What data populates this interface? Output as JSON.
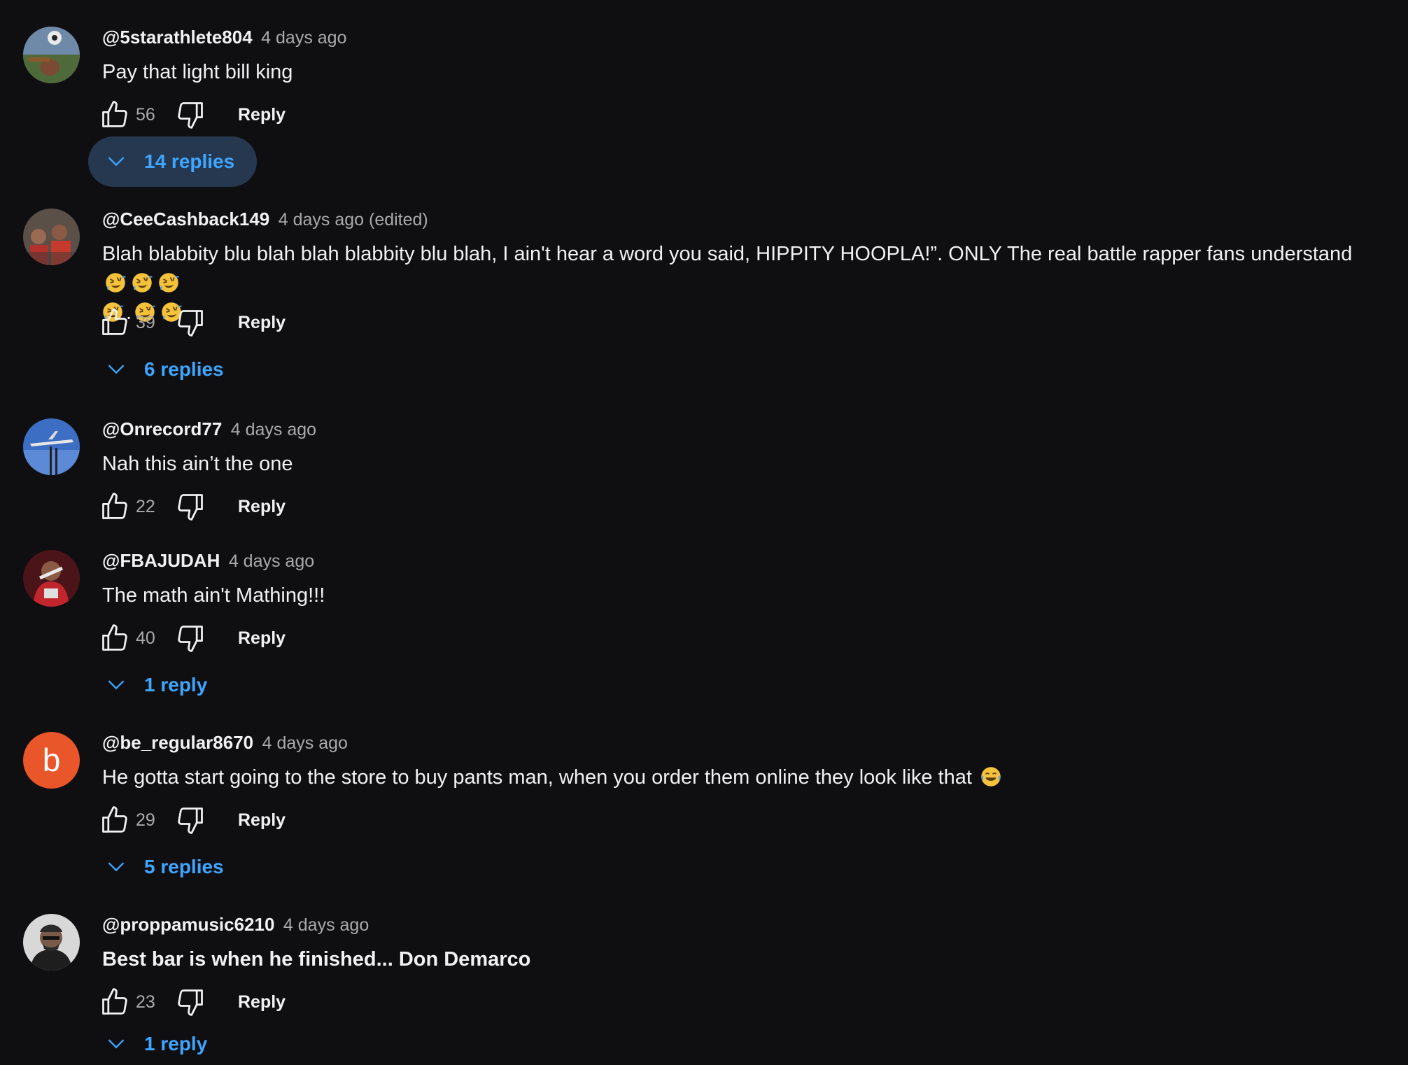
{
  "comments": [
    {
      "author": "@5starathlete804",
      "time": "4 days ago",
      "text": "Pay that light bill king",
      "likes": "56",
      "reply_label": "Reply",
      "replies_label": "14 replies"
    },
    {
      "author": "@CeeCashback149",
      "time": "4 days ago (edited)",
      "text": "Blah blabbity blu blah blah blabbity blu blah, I ain't hear a word you said, HIPPITY HOOPLA!”. ONLY The real battle rapper fans understand",
      "text_line2_sep": ".",
      "emoji": "rolling-on-floor-laughing",
      "likes": "39",
      "reply_label": "Reply",
      "replies_label": "6 replies"
    },
    {
      "author": "@Onrecord77",
      "time": "4 days ago",
      "text": "Nah this ain’t the one",
      "likes": "22",
      "reply_label": "Reply"
    },
    {
      "author": "@FBAJUDAH",
      "time": "4 days ago",
      "text": "The math ain't Mathing!!!",
      "likes": "40",
      "reply_label": "Reply",
      "replies_label": "1 reply"
    },
    {
      "author": "@be_regular8670",
      "time": "4 days ago",
      "avatar_letter": "b",
      "text": "He gotta start going to the store to buy pants man, when you order them online they look like that",
      "emoji": "face-with-tears-of-joy",
      "likes": "29",
      "reply_label": "Reply",
      "replies_label": "5 replies"
    },
    {
      "author": "@proppamusic6210",
      "time": "4 days ago",
      "text": "Best bar is when he finished... Don Demarco",
      "likes": "23",
      "reply_label": "Reply",
      "replies_label": "1 reply"
    }
  ],
  "icons": {
    "like": "thumbs-up-icon",
    "dislike": "thumbs-down-icon",
    "expand": "chevron-down-icon"
  },
  "colors": {
    "background": "#0f0f12",
    "link_blue": "#3ea6ff",
    "active_toggle_bg": "#263850",
    "avatar_orange": "#e8562a"
  }
}
